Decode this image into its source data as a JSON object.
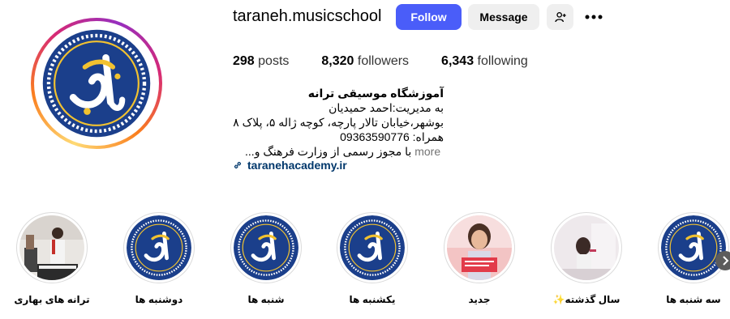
{
  "profile": {
    "username": "taraneh.musicschool",
    "follow_label": "Follow",
    "message_label": "Message",
    "stats": {
      "posts_count": "298",
      "posts_label": "posts",
      "followers_count": "8,320",
      "followers_label": "followers",
      "following_count": "6,343",
      "following_label": "following"
    },
    "bio": {
      "name": "آموزشگاه موسیقی ترانه",
      "line1": "به مدیریت:احمد حمیدیان",
      "line2": "بوشهر،خیابان تالار پارچه، کوچه ژاله ۵، پلاک ۸",
      "line3": "همراه: 09363590776",
      "line4": "با مجوز رسمی از وزارت فرهنگ و...",
      "more": "more",
      "link": "taranehacademy.ir"
    }
  },
  "colors": {
    "follow_button": "#4a5df9",
    "logo_blue": "#1b3f8b",
    "logo_yellow": "#f2c230",
    "link": "#00376b"
  },
  "highlights": [
    {
      "label": "ترانه های بهاری",
      "thumb": "photo-performance"
    },
    {
      "label": "دوشنبه ها",
      "thumb": "logo"
    },
    {
      "label": "شنبه ها",
      "thumb": "logo"
    },
    {
      "label": "یکشنبه ها",
      "thumb": "logo"
    },
    {
      "label": "جدید",
      "thumb": "photo-child"
    },
    {
      "label": "سال گذشته✨",
      "thumb": "photo-class"
    },
    {
      "label": "سه شنبه ها",
      "thumb": "logo"
    }
  ],
  "icons": {
    "add_user": "person-add-icon",
    "more": "more-dots-icon",
    "link": "link-chain-icon",
    "next": "chevron-right-icon"
  }
}
